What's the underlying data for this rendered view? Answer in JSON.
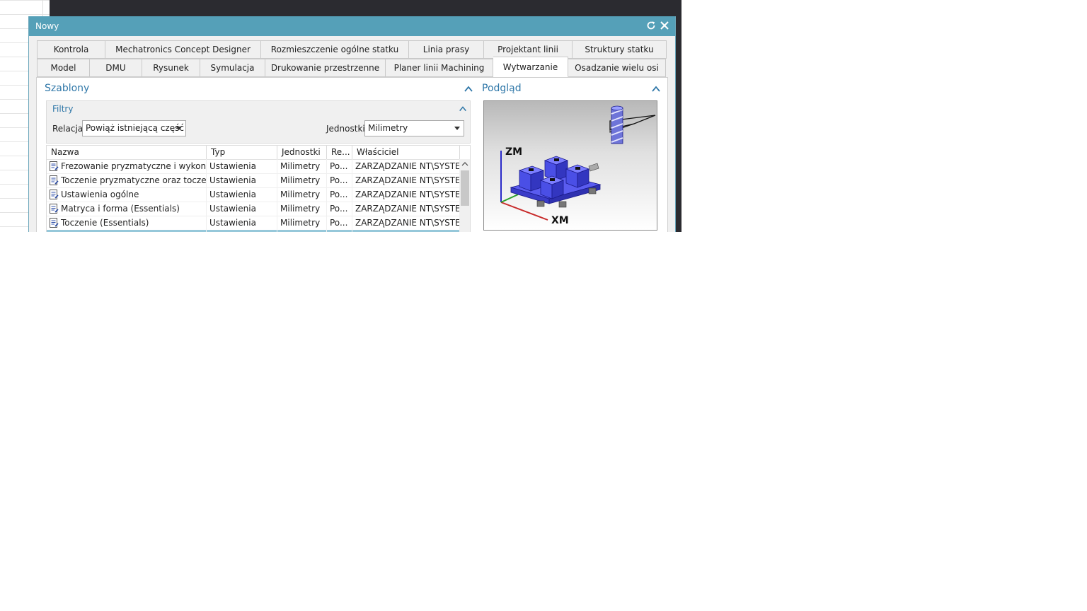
{
  "window": {
    "title": "Nowy"
  },
  "tabs": {
    "row1": [
      "Kontrola",
      "Mechatronics Concept Designer",
      "Rozmieszczenie ogólne statku",
      "Linia prasy",
      "Projektant linii",
      "Struktury statku"
    ],
    "row2": [
      "Model",
      "DMU",
      "Rysunek",
      "Symulacja",
      "Drukowanie przestrzenne",
      "Planer linii Machining",
      "Wytwarzanie",
      "Osadzanie wielu osi"
    ],
    "active": "Wytwarzanie"
  },
  "templates": {
    "title": "Szablony",
    "filters": {
      "title": "Filtry",
      "relation_label": "Relacja",
      "relation_value": "Powiąż istniejącą część",
      "units_label": "Jednostki",
      "units_value": "Milimetry"
    },
    "columns": [
      "Nazwa",
      "Typ",
      "Jednostki",
      "Re...",
      "Właściciel"
    ],
    "rows": [
      {
        "name": "Frezowanie pryzmatyczne i wykony...",
        "type": "Ustawienia",
        "units": "Milimetry",
        "re": "Po...",
        "owner": "ZARZĄDZANIE NT\\SYSTEM"
      },
      {
        "name": "Toczenie pryzmatyczne oraz toczeni...",
        "type": "Ustawienia",
        "units": "Milimetry",
        "re": "Po...",
        "owner": "ZARZĄDZANIE NT\\SYSTEM"
      },
      {
        "name": "Ustawienia ogólne",
        "type": "Ustawienia",
        "units": "Milimetry",
        "re": "Po...",
        "owner": "ZARZĄDZANIE NT\\SYSTEM"
      },
      {
        "name": "Matryca i forma (Essentials)",
        "type": "Ustawienia",
        "units": "Milimetry",
        "re": "Po...",
        "owner": "ZARZĄDZANIE NT\\SYSTEM"
      },
      {
        "name": "Toczenie (Essentials)",
        "type": "Ustawienia",
        "units": "Milimetry",
        "re": "Po...",
        "owner": "ZARZĄDZANIE NT\\SYSTEM"
      },
      {
        "name": "",
        "type": "",
        "units": "",
        "re": "",
        "owner": ""
      }
    ]
  },
  "preview": {
    "title": "Podgląd",
    "axis_z": "ZM",
    "axis_x": "XM"
  },
  "colors": {
    "titlebar": "#55a0b8",
    "accent_text": "#2f77a8",
    "selection": "#96c8da",
    "part_blue": "#4a4fe6"
  }
}
